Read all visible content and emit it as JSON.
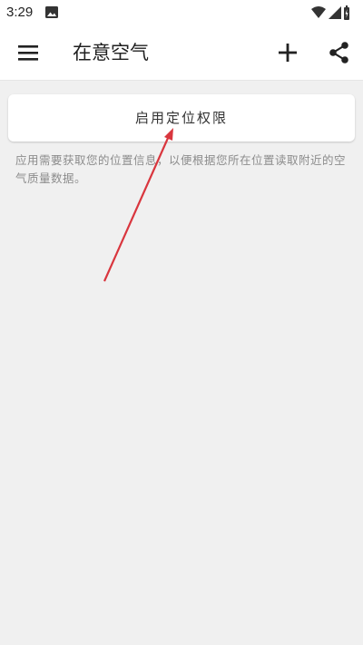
{
  "status_bar": {
    "time": "3:29",
    "icons": [
      "gallery-icon",
      "wifi-icon",
      "signal-icon",
      "battery-charging-icon"
    ]
  },
  "app_bar": {
    "title": "在意空气",
    "menu_icon": "menu-icon",
    "add_icon": "add-icon",
    "share_icon": "share-icon"
  },
  "main": {
    "enable_location_button": "启用定位权限",
    "permission_note": "应用需要获取您的位置信息，以便根据您所在位置读取附近的空气质量数据。"
  },
  "colors": {
    "background": "#f0f0f0",
    "annotation_arrow": "#d9363e"
  }
}
